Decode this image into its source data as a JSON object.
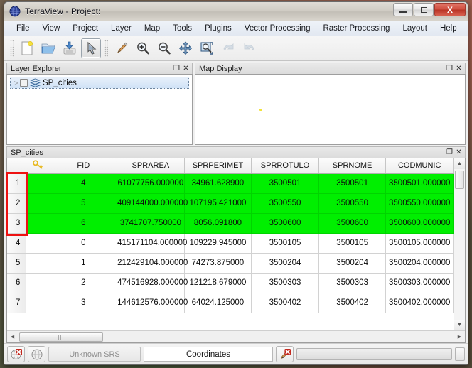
{
  "window": {
    "title": "TerraView - Project:",
    "app_icon": "globe-icon",
    "buttons": {
      "minimize": "minimize-icon",
      "maximize": "maximize-icon",
      "close": "X"
    }
  },
  "menu": {
    "items": [
      {
        "label": "File"
      },
      {
        "label": "View"
      },
      {
        "label": "Project"
      },
      {
        "label": "Layer"
      },
      {
        "label": "Map"
      },
      {
        "label": "Tools"
      },
      {
        "label": "Plugins"
      },
      {
        "label": "Vector Processing"
      },
      {
        "label": "Raster Processing"
      },
      {
        "label": "Layout"
      },
      {
        "label": "Help"
      }
    ]
  },
  "toolbar": {
    "items": [
      {
        "name": "new-project-icon",
        "enabled": true,
        "active": false
      },
      {
        "name": "open-project-icon",
        "enabled": true,
        "active": false
      },
      {
        "name": "save-project-icon",
        "enabled": true,
        "active": false
      },
      {
        "name": "pointer-select-icon",
        "enabled": true,
        "active": true
      },
      {
        "name": "pencil-draw-icon",
        "enabled": true,
        "active": false
      },
      {
        "name": "zoom-in-icon",
        "enabled": true,
        "active": false
      },
      {
        "name": "zoom-out-icon",
        "enabled": true,
        "active": false
      },
      {
        "name": "pan-icon",
        "enabled": true,
        "active": false
      },
      {
        "name": "zoom-extent-icon",
        "enabled": true,
        "active": false
      },
      {
        "name": "undo-icon",
        "enabled": false,
        "active": false
      },
      {
        "name": "redo-icon",
        "enabled": false,
        "active": false
      }
    ]
  },
  "layer_explorer": {
    "title": "Layer Explorer",
    "float_label": "❐",
    "close_label": "✕",
    "tree": [
      {
        "label": "SP_cities",
        "expander": "▷",
        "checked": false,
        "selected": true,
        "icon": "layers-icon"
      }
    ]
  },
  "map_display": {
    "title": "Map Display",
    "float_label": "❐",
    "close_label": "✕"
  },
  "attribute_table": {
    "title": "SP_cities",
    "float_label": "❐",
    "close_label": "✕",
    "key_icon": "key-icon",
    "columns": [
      "FID",
      "SPRAREA",
      "SPRPERIMET",
      "SPRROTULO",
      "SPRNOME",
      "CODMUNIC"
    ],
    "selected_color": "#00ef00",
    "rows": [
      {
        "num": "1",
        "selected": true,
        "cells": [
          "4",
          "61077756.000000",
          "34961.628900",
          "3500501",
          "3500501",
          "3500501.000000"
        ]
      },
      {
        "num": "2",
        "selected": true,
        "cells": [
          "5",
          "409144000.000000",
          "107195.421000",
          "3500550",
          "3500550",
          "3500550.000000"
        ]
      },
      {
        "num": "3",
        "selected": true,
        "cells": [
          "6",
          "3741707.750000",
          "8056.091800",
          "3500600",
          "3500600",
          "3500600.000000"
        ]
      },
      {
        "num": "4",
        "selected": false,
        "cells": [
          "0",
          "415171104.000000",
          "109229.945000",
          "3500105",
          "3500105",
          "3500105.000000"
        ]
      },
      {
        "num": "5",
        "selected": false,
        "cells": [
          "1",
          "212429104.000000",
          "74273.875000",
          "3500204",
          "3500204",
          "3500204.000000"
        ]
      },
      {
        "num": "6",
        "selected": false,
        "cells": [
          "2",
          "474516928.000000",
          "121218.679000",
          "3500303",
          "3500303",
          "3500303.000000"
        ]
      },
      {
        "num": "7",
        "selected": false,
        "cells": [
          "3",
          "144612576.000000",
          "64024.125000",
          "3500402",
          "3500402",
          "3500402.000000"
        ]
      }
    ],
    "scroll": {
      "up_arrow": "▲",
      "down_arrow": "▼",
      "left_arrow": "◀",
      "right_arrow": "▶",
      "thumb_grip": "|||"
    }
  },
  "statusbar": {
    "srs_label": "Unknown SRS",
    "coordinates_label": "Coordinates",
    "icons": {
      "srs_error": "globe-error-icon",
      "globe": "globe-icon",
      "draw_error": "pencil-error-icon"
    },
    "more_label": "···"
  },
  "annotation": {
    "color": "#ee1111",
    "target": "row-header-cells-1-to-3"
  }
}
